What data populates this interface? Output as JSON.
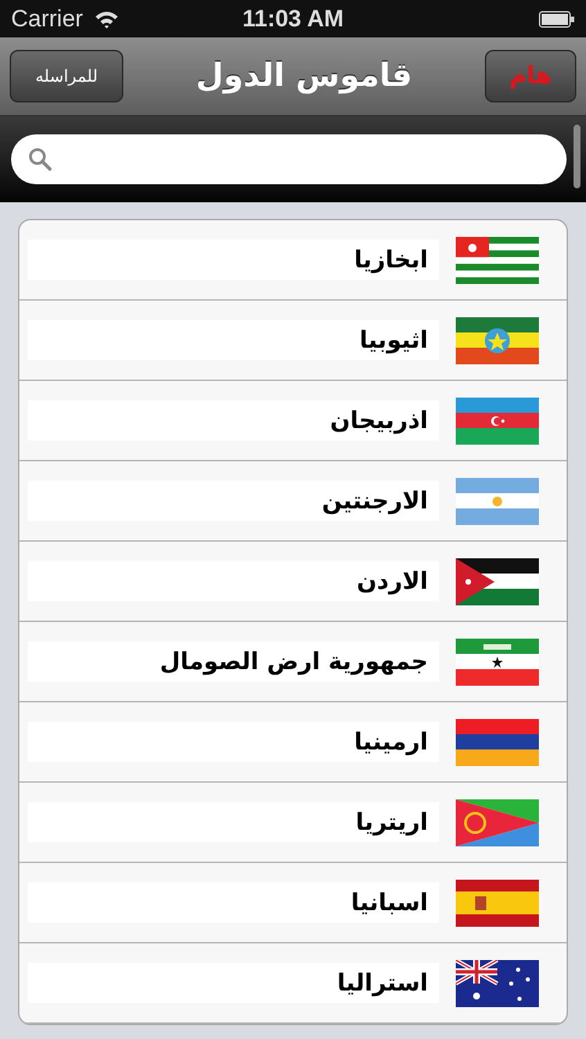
{
  "status_bar": {
    "carrier": "Carrier",
    "time": "11:03 AM"
  },
  "nav_bar": {
    "title": "قاموس الدول",
    "left_button": "للمراسله",
    "right_button": "هام"
  },
  "countries": [
    {
      "name": "ابخازيا"
    },
    {
      "name": "اثيوبيا"
    },
    {
      "name": "اذربيجان"
    },
    {
      "name": "الارجنتين"
    },
    {
      "name": "الاردن"
    },
    {
      "name": "جمهورية ارض الصومال"
    },
    {
      "name": "ارمينيا"
    },
    {
      "name": "اريتريا"
    },
    {
      "name": "اسبانيا"
    },
    {
      "name": "استراليا"
    }
  ]
}
